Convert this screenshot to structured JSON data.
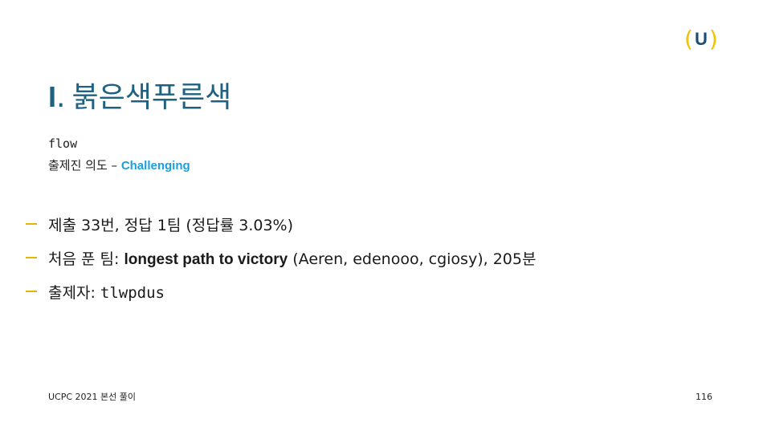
{
  "logo": {
    "left_paren": "(",
    "letter": "U",
    "right_paren": ")"
  },
  "title": {
    "number": "I",
    "dot": ".",
    "text": "붉은색푸른색"
  },
  "subtitle": {
    "line1": "flow",
    "line2_prefix": "출제진 의도 – ",
    "line2_highlight": "Challenging"
  },
  "bullets": [
    {
      "text": "제출 33번, 정답 1팀 (정답률 3.03%)"
    },
    {
      "prefix": "처음 푼 팀: ",
      "bold": "longest path to victory",
      "suffix": " (Aeren, edenooo, cgiosy), 205분"
    },
    {
      "prefix": "출제자: ",
      "mono": "tlwpdus"
    }
  ],
  "footer": {
    "left": "UCPC 2021 본선 풀이",
    "page": "116"
  },
  "colors": {
    "title": "#1e6180",
    "accent": "#e8b400",
    "highlight": "#1aa0e0"
  }
}
